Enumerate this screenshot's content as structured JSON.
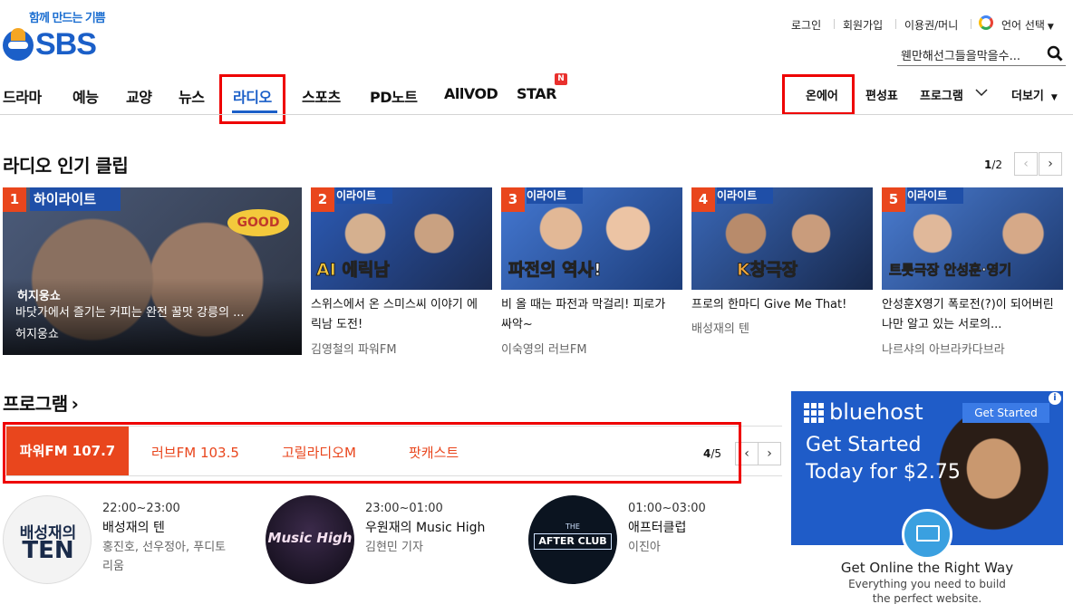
{
  "header": {
    "tagline": "함께 만드는 기쁨",
    "logo_text": "SBS",
    "util": {
      "login": "로그인",
      "signup": "회원가입",
      "ticket": "이용권/머니",
      "language": "언어 선택"
    },
    "search_text": "웬만해선그들을막을수..."
  },
  "nav": {
    "items": [
      "드라마",
      "예능",
      "교양",
      "뉴스",
      "라디오",
      "스포츠",
      "PD노트",
      "AllVOD",
      "STAR"
    ],
    "active": "라디오",
    "new_badge": "N",
    "right": {
      "onair": "온에어",
      "schedule": "편성표",
      "program": "프로그램",
      "more": "더보기"
    }
  },
  "clips": {
    "title": "라디오 인기 클립",
    "pager_current": "1",
    "pager_total": "/2",
    "items": [
      {
        "rank": "1",
        "overlay_tag": "하이라이트",
        "overlay_title": "바닷가에서 즐기는 커피는 완전 꿀맛 강릉의 ...",
        "overlay_sub": "허지웅쇼",
        "thumb_caption": "허지웅쇼"
      },
      {
        "rank": "2",
        "tag": "이라이트",
        "caption": "AI 에릭남",
        "title": "스위스에서 온 스미스씨 이야기 에릭남 도전!",
        "sub": "김영철의 파워FM"
      },
      {
        "rank": "3",
        "tag": "이라이트",
        "caption": "파전의 역사!",
        "title": "비 올 때는 파전과 막걸리! 피로가 싸악~",
        "sub": "이숙영의 러브FM"
      },
      {
        "rank": "4",
        "tag": "이라이트",
        "caption": "K창극장",
        "title": "프로의 한마디 Give Me That!",
        "sub": "배성재의 텐"
      },
      {
        "rank": "5",
        "tag": "이라이트",
        "caption": "트롯극장 안성훈·영기",
        "title": "안성훈X영기 폭로전(?)이 되어버린 나만 알고 있는 서로의...",
        "sub": "나르샤의 아브라카다브라"
      }
    ]
  },
  "programs": {
    "title": "프로그램",
    "tabs": [
      "파워FM 107.7",
      "러브FM 103.5",
      "고릴라디오M",
      "팟캐스트"
    ],
    "pager_current": "4",
    "pager_total": "/5",
    "items": [
      {
        "time": "22:00~23:00",
        "name": "배성재의 텐",
        "host1": "홍진호, 선우정아, 푸디토",
        "host2": "리움",
        "logo_line1": "배성재의",
        "logo_line2": "TEN"
      },
      {
        "time": "23:00~01:00",
        "name": "우원재의 Music High",
        "host1": "김현민 기자",
        "host2": "",
        "logo_line1": "Music High",
        "logo_line2": ""
      },
      {
        "time": "01:00~03:00",
        "name": "애프터클럽",
        "host1": "이진아",
        "host2": "",
        "logo_line1": "AFTER CLUB",
        "logo_line2": "THE"
      }
    ]
  },
  "ad": {
    "brand": "bluehost",
    "cta": "Get Started",
    "headline1": "Get Started",
    "headline2": "Today for $2.75",
    "footer1": "Get Online the Right Way",
    "footer2": "Everything you need to build",
    "footer3": "the perfect website."
  },
  "colors": {
    "brand": "#1b5fc8",
    "accent": "#e9461d",
    "highlight": "#e00000"
  }
}
